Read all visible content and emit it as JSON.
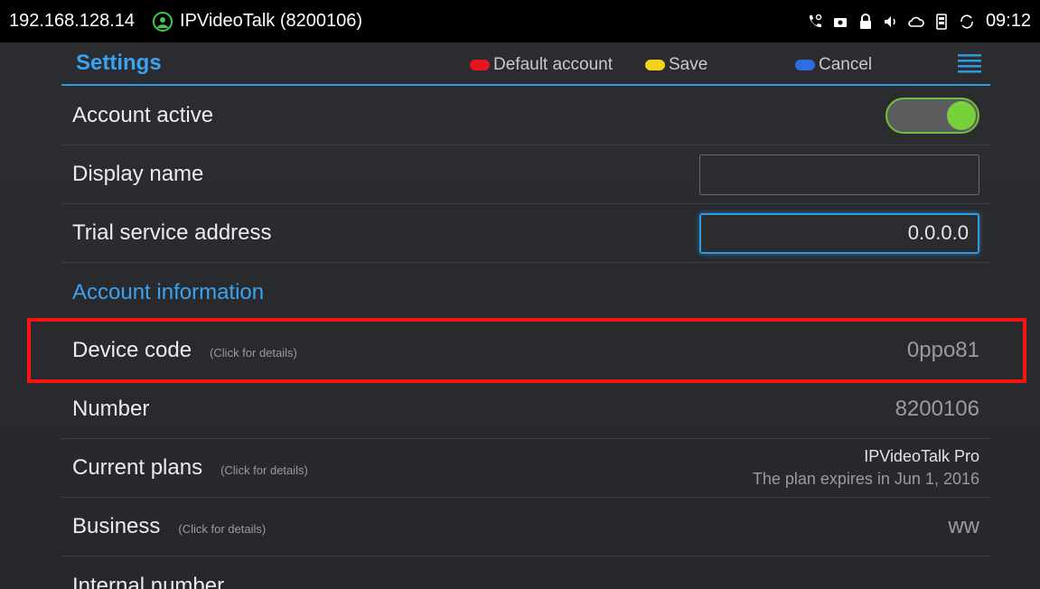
{
  "statusbar": {
    "ip": "192.168.128.14",
    "app_title": "IPVideoTalk (8200106)",
    "time": "09:12",
    "icons": [
      "call-icon",
      "camera-icon",
      "lock-icon",
      "volume-icon",
      "cloud-icon",
      "storage-icon",
      "sync-icon"
    ]
  },
  "header": {
    "title": "Settings",
    "actions": [
      {
        "label": "Default account",
        "color": "#e8141e"
      },
      {
        "label": "Save",
        "color": "#f2d21c"
      },
      {
        "label": "Cancel",
        "color": "#2d6fe0"
      }
    ]
  },
  "rows": {
    "account_active": {
      "label": "Account active",
      "value": true
    },
    "display_name": {
      "label": "Display name",
      "value": ""
    },
    "trial_address": {
      "label": "Trial service address",
      "value": "0.0.0.0"
    },
    "section_account_info": {
      "label": "Account information"
    },
    "device_code": {
      "label": "Device code",
      "hint": "(Click for details)",
      "value": "0ppo81"
    },
    "number": {
      "label": "Number",
      "value": "8200106"
    },
    "current_plans": {
      "label": "Current plans",
      "hint": "(Click for details)",
      "plan": "IPVideoTalk Pro",
      "expiry": "The plan expires in Jun 1, 2016"
    },
    "business": {
      "label": "Business",
      "hint": "(Click for details)",
      "value": "ww"
    },
    "internal_number": {
      "label": "Internal number"
    }
  },
  "colors": {
    "accent": "#3aa2f0",
    "highlight": "#ff1010",
    "toggle_on": "#78d13a"
  }
}
